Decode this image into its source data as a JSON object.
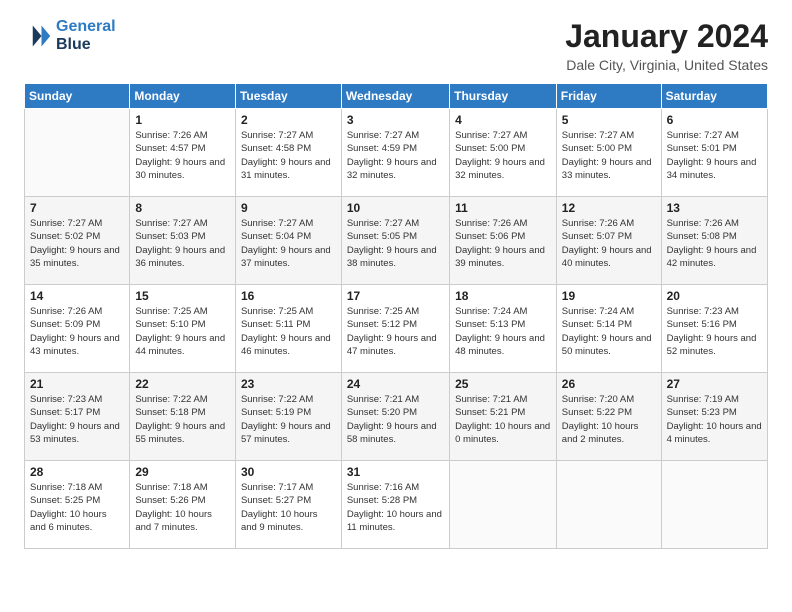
{
  "logo": {
    "line1": "General",
    "line2": "Blue"
  },
  "title": "January 2024",
  "location": "Dale City, Virginia, United States",
  "weekdays": [
    "Sunday",
    "Monday",
    "Tuesday",
    "Wednesday",
    "Thursday",
    "Friday",
    "Saturday"
  ],
  "weeks": [
    [
      {
        "num": "",
        "sunrise": "",
        "sunset": "",
        "daylight": ""
      },
      {
        "num": "1",
        "sunrise": "Sunrise: 7:26 AM",
        "sunset": "Sunset: 4:57 PM",
        "daylight": "Daylight: 9 hours and 30 minutes."
      },
      {
        "num": "2",
        "sunrise": "Sunrise: 7:27 AM",
        "sunset": "Sunset: 4:58 PM",
        "daylight": "Daylight: 9 hours and 31 minutes."
      },
      {
        "num": "3",
        "sunrise": "Sunrise: 7:27 AM",
        "sunset": "Sunset: 4:59 PM",
        "daylight": "Daylight: 9 hours and 32 minutes."
      },
      {
        "num": "4",
        "sunrise": "Sunrise: 7:27 AM",
        "sunset": "Sunset: 5:00 PM",
        "daylight": "Daylight: 9 hours and 32 minutes."
      },
      {
        "num": "5",
        "sunrise": "Sunrise: 7:27 AM",
        "sunset": "Sunset: 5:00 PM",
        "daylight": "Daylight: 9 hours and 33 minutes."
      },
      {
        "num": "6",
        "sunrise": "Sunrise: 7:27 AM",
        "sunset": "Sunset: 5:01 PM",
        "daylight": "Daylight: 9 hours and 34 minutes."
      }
    ],
    [
      {
        "num": "7",
        "sunrise": "Sunrise: 7:27 AM",
        "sunset": "Sunset: 5:02 PM",
        "daylight": "Daylight: 9 hours and 35 minutes."
      },
      {
        "num": "8",
        "sunrise": "Sunrise: 7:27 AM",
        "sunset": "Sunset: 5:03 PM",
        "daylight": "Daylight: 9 hours and 36 minutes."
      },
      {
        "num": "9",
        "sunrise": "Sunrise: 7:27 AM",
        "sunset": "Sunset: 5:04 PM",
        "daylight": "Daylight: 9 hours and 37 minutes."
      },
      {
        "num": "10",
        "sunrise": "Sunrise: 7:27 AM",
        "sunset": "Sunset: 5:05 PM",
        "daylight": "Daylight: 9 hours and 38 minutes."
      },
      {
        "num": "11",
        "sunrise": "Sunrise: 7:26 AM",
        "sunset": "Sunset: 5:06 PM",
        "daylight": "Daylight: 9 hours and 39 minutes."
      },
      {
        "num": "12",
        "sunrise": "Sunrise: 7:26 AM",
        "sunset": "Sunset: 5:07 PM",
        "daylight": "Daylight: 9 hours and 40 minutes."
      },
      {
        "num": "13",
        "sunrise": "Sunrise: 7:26 AM",
        "sunset": "Sunset: 5:08 PM",
        "daylight": "Daylight: 9 hours and 42 minutes."
      }
    ],
    [
      {
        "num": "14",
        "sunrise": "Sunrise: 7:26 AM",
        "sunset": "Sunset: 5:09 PM",
        "daylight": "Daylight: 9 hours and 43 minutes."
      },
      {
        "num": "15",
        "sunrise": "Sunrise: 7:25 AM",
        "sunset": "Sunset: 5:10 PM",
        "daylight": "Daylight: 9 hours and 44 minutes."
      },
      {
        "num": "16",
        "sunrise": "Sunrise: 7:25 AM",
        "sunset": "Sunset: 5:11 PM",
        "daylight": "Daylight: 9 hours and 46 minutes."
      },
      {
        "num": "17",
        "sunrise": "Sunrise: 7:25 AM",
        "sunset": "Sunset: 5:12 PM",
        "daylight": "Daylight: 9 hours and 47 minutes."
      },
      {
        "num": "18",
        "sunrise": "Sunrise: 7:24 AM",
        "sunset": "Sunset: 5:13 PM",
        "daylight": "Daylight: 9 hours and 48 minutes."
      },
      {
        "num": "19",
        "sunrise": "Sunrise: 7:24 AM",
        "sunset": "Sunset: 5:14 PM",
        "daylight": "Daylight: 9 hours and 50 minutes."
      },
      {
        "num": "20",
        "sunrise": "Sunrise: 7:23 AM",
        "sunset": "Sunset: 5:16 PM",
        "daylight": "Daylight: 9 hours and 52 minutes."
      }
    ],
    [
      {
        "num": "21",
        "sunrise": "Sunrise: 7:23 AM",
        "sunset": "Sunset: 5:17 PM",
        "daylight": "Daylight: 9 hours and 53 minutes."
      },
      {
        "num": "22",
        "sunrise": "Sunrise: 7:22 AM",
        "sunset": "Sunset: 5:18 PM",
        "daylight": "Daylight: 9 hours and 55 minutes."
      },
      {
        "num": "23",
        "sunrise": "Sunrise: 7:22 AM",
        "sunset": "Sunset: 5:19 PM",
        "daylight": "Daylight: 9 hours and 57 minutes."
      },
      {
        "num": "24",
        "sunrise": "Sunrise: 7:21 AM",
        "sunset": "Sunset: 5:20 PM",
        "daylight": "Daylight: 9 hours and 58 minutes."
      },
      {
        "num": "25",
        "sunrise": "Sunrise: 7:21 AM",
        "sunset": "Sunset: 5:21 PM",
        "daylight": "Daylight: 10 hours and 0 minutes."
      },
      {
        "num": "26",
        "sunrise": "Sunrise: 7:20 AM",
        "sunset": "Sunset: 5:22 PM",
        "daylight": "Daylight: 10 hours and 2 minutes."
      },
      {
        "num": "27",
        "sunrise": "Sunrise: 7:19 AM",
        "sunset": "Sunset: 5:23 PM",
        "daylight": "Daylight: 10 hours and 4 minutes."
      }
    ],
    [
      {
        "num": "28",
        "sunrise": "Sunrise: 7:18 AM",
        "sunset": "Sunset: 5:25 PM",
        "daylight": "Daylight: 10 hours and 6 minutes."
      },
      {
        "num": "29",
        "sunrise": "Sunrise: 7:18 AM",
        "sunset": "Sunset: 5:26 PM",
        "daylight": "Daylight: 10 hours and 7 minutes."
      },
      {
        "num": "30",
        "sunrise": "Sunrise: 7:17 AM",
        "sunset": "Sunset: 5:27 PM",
        "daylight": "Daylight: 10 hours and 9 minutes."
      },
      {
        "num": "31",
        "sunrise": "Sunrise: 7:16 AM",
        "sunset": "Sunset: 5:28 PM",
        "daylight": "Daylight: 10 hours and 11 minutes."
      },
      {
        "num": "",
        "sunrise": "",
        "sunset": "",
        "daylight": ""
      },
      {
        "num": "",
        "sunrise": "",
        "sunset": "",
        "daylight": ""
      },
      {
        "num": "",
        "sunrise": "",
        "sunset": "",
        "daylight": ""
      }
    ]
  ]
}
